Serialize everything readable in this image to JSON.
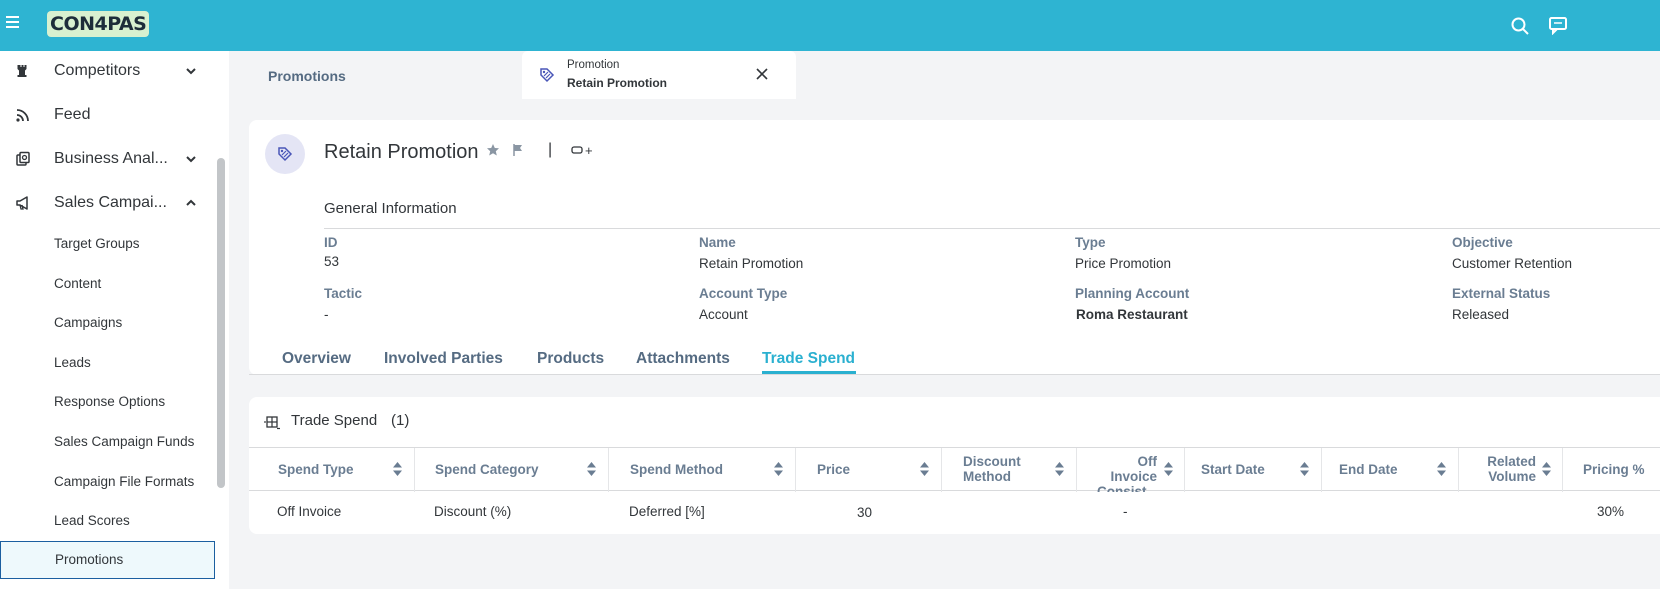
{
  "app": {
    "logo_text": "CON4PAS"
  },
  "sidebar": {
    "items": [
      {
        "label": "Competitors",
        "icon": "chess-rook-icon",
        "expandable": true,
        "expanded": false
      },
      {
        "label": "Feed",
        "icon": "feed-icon",
        "expandable": false
      },
      {
        "label": "Business Anal...",
        "icon": "business-analytics-icon",
        "expandable": true,
        "expanded": false
      },
      {
        "label": "Sales Campai...",
        "icon": "megaphone-icon",
        "expandable": true,
        "expanded": true
      }
    ],
    "sub_items": [
      {
        "label": "Target Groups"
      },
      {
        "label": "Content"
      },
      {
        "label": "Campaigns"
      },
      {
        "label": "Leads"
      },
      {
        "label": "Response Options"
      },
      {
        "label": "Sales Campaign Funds"
      },
      {
        "label": "Campaign File Formats"
      },
      {
        "label": "Lead Scores"
      },
      {
        "label": "Promotions",
        "selected": true
      }
    ]
  },
  "tabs": {
    "first": {
      "label": "Promotions"
    },
    "active": {
      "type_label": "Promotion",
      "title": "Retain Promotion"
    }
  },
  "object": {
    "title": "Retain Promotion",
    "separator": "|",
    "tag_plus": "+",
    "section_title": "General Information",
    "fields": {
      "id": {
        "label": "ID",
        "value": "53"
      },
      "name": {
        "label": "Name",
        "value": "Retain Promotion"
      },
      "type": {
        "label": "Type",
        "value": "Price Promotion"
      },
      "objective": {
        "label": "Objective",
        "value": "Customer Retention"
      },
      "tactic": {
        "label": "Tactic",
        "value": "-"
      },
      "account_type": {
        "label": "Account Type",
        "value": "Account"
      },
      "planning_account": {
        "label": "Planning Account",
        "value": "Roma Restaurant"
      },
      "external_status": {
        "label": "External Status",
        "value": "Released"
      }
    },
    "tabs": [
      "Overview",
      "Involved Parties",
      "Products",
      "Attachments",
      "Trade Spend"
    ],
    "active_tab": "Trade Spend"
  },
  "trade_spend": {
    "title": "Trade Spend",
    "count": "(1)",
    "columns": {
      "spend_type": "Spend Type",
      "spend_category": "Spend Category",
      "spend_method": "Spend Method",
      "price": "Price",
      "discount_method_1": "Discount",
      "discount_method_2": "Method",
      "off_invoice_1": "Off",
      "off_invoice_2": "Invoice",
      "off_invoice_3": "Consist...",
      "start_date": "Start Date",
      "end_date": "End Date",
      "related_volume_1": "Related",
      "related_volume_2": "Volume",
      "pricing_pct": "Pricing %"
    },
    "rows": [
      {
        "spend_type": "Off Invoice",
        "spend_category": "Discount (%)",
        "spend_method": "Deferred [%]",
        "price": "30",
        "off_invoice": "-",
        "pricing_pct": "30%"
      }
    ]
  },
  "colors": {
    "topbar": "#2eb4d2",
    "accent": "#2ab0d0",
    "label": "#6a7d92",
    "selected_border": "#1b5fa0"
  }
}
